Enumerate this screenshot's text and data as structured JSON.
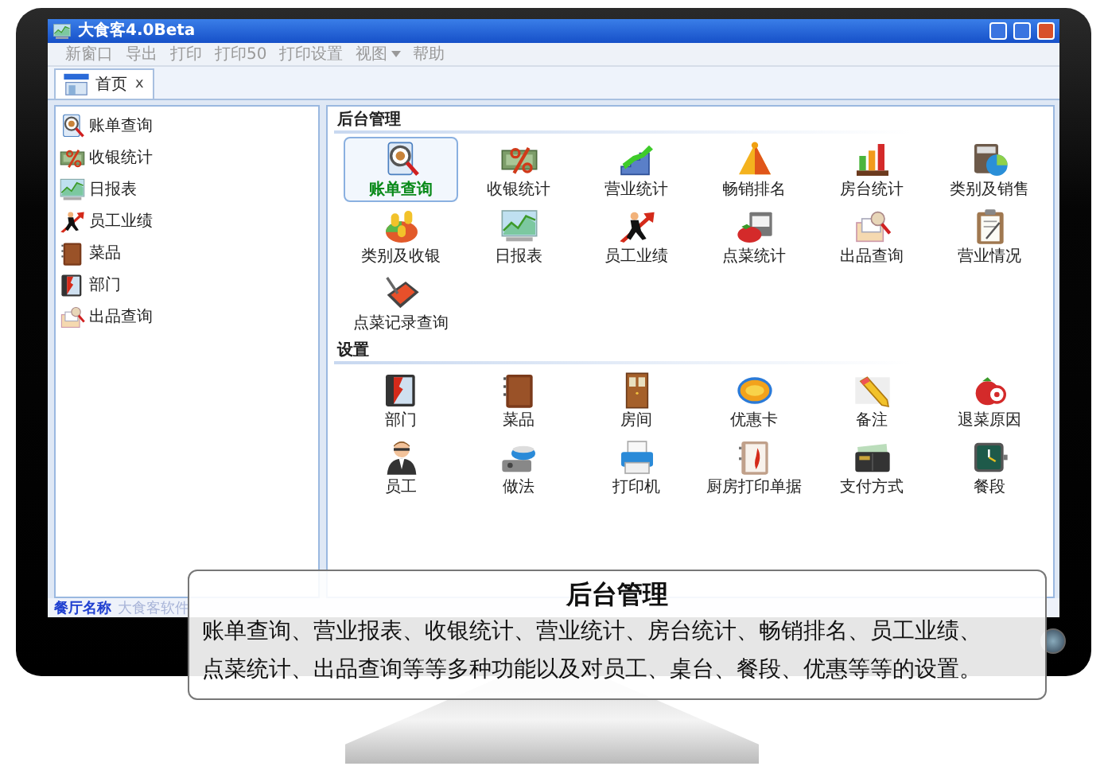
{
  "window": {
    "title": "大食客4.0Beta"
  },
  "menu": [
    {
      "label": "新窗口",
      "has_submenu": false
    },
    {
      "label": "导出",
      "has_submenu": false
    },
    {
      "label": "打印",
      "has_submenu": false
    },
    {
      "label": "打印50",
      "has_submenu": false
    },
    {
      "label": "打印设置",
      "has_submenu": false
    },
    {
      "label": "视图",
      "has_submenu": true
    },
    {
      "label": "帮助",
      "has_submenu": false
    }
  ],
  "tabs": [
    {
      "label": "首页",
      "close": "x",
      "selected": true
    }
  ],
  "sidebar": {
    "items": [
      {
        "label": "账单查询"
      },
      {
        "label": "收银统计"
      },
      {
        "label": "日报表"
      },
      {
        "label": "员工业绩"
      },
      {
        "label": "菜品"
      },
      {
        "label": "部门"
      },
      {
        "label": "出品查询"
      }
    ]
  },
  "sections": [
    {
      "title": "后台管理",
      "tiles": [
        {
          "label": "账单查询",
          "selected": true
        },
        {
          "label": "收银统计",
          "selected": false
        },
        {
          "label": "营业统计",
          "selected": false
        },
        {
          "label": "畅销排名",
          "selected": false
        },
        {
          "label": "房台统计",
          "selected": false
        },
        {
          "label": "类别及销售",
          "selected": false
        },
        {
          "label": "类别及收银",
          "selected": false
        },
        {
          "label": "日报表",
          "selected": false
        },
        {
          "label": "员工业绩",
          "selected": false
        },
        {
          "label": "点菜统计",
          "selected": false
        },
        {
          "label": "出品查询",
          "selected": false
        },
        {
          "label": "营业情况",
          "selected": false
        },
        {
          "label": "点菜记录查询",
          "selected": false
        }
      ]
    },
    {
      "title": "设置",
      "tiles": [
        {
          "label": "部门",
          "selected": false
        },
        {
          "label": "菜品",
          "selected": false
        },
        {
          "label": "房间",
          "selected": false
        },
        {
          "label": "优惠卡",
          "selected": false
        },
        {
          "label": "备注",
          "selected": false
        },
        {
          "label": "退菜原因",
          "selected": false
        },
        {
          "label": "员工",
          "selected": false
        },
        {
          "label": "做法",
          "selected": false
        },
        {
          "label": "打印机",
          "selected": false
        },
        {
          "label": "厨房打印单据",
          "selected": false
        },
        {
          "label": "支付方式",
          "selected": false
        },
        {
          "label": "餐段",
          "selected": false
        }
      ]
    }
  ],
  "status_bar": {
    "label": "餐厅名称",
    "value": "大食客软件"
  },
  "caption": {
    "title": "后台管理",
    "lines": [
      "账单查询、营业报表、收银统计、营业统计、房台统计、畅销排名、员工业绩、",
      "点菜统计、出品查询等等多种功能以及对员工、桌台、餐段、优惠等等的设置。"
    ]
  }
}
